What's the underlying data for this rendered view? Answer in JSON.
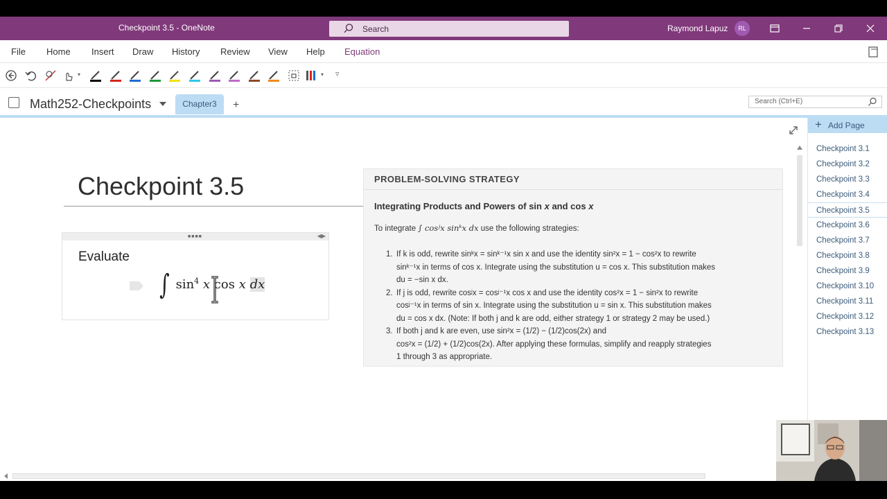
{
  "window": {
    "title": "Checkpoint 3.5  -  OneNote",
    "search_placeholder": "Search",
    "user_name": "Raymond Lapuz",
    "user_initials": "RL"
  },
  "menu": {
    "items": [
      "File",
      "Home",
      "Insert",
      "Draw",
      "History",
      "Review",
      "View",
      "Help",
      "Equation"
    ],
    "active": "Equation"
  },
  "toolbar": {
    "pen_colors": [
      "#000000",
      "#d9251d",
      "#1f6fd1",
      "#1c9a3c",
      "#f3e000",
      "#2ec9e6",
      "#9b59b6",
      "#c06ac9",
      "#8b4a2b",
      "#f08a1c"
    ]
  },
  "notebook": {
    "name": "Math252-Checkpoints",
    "section": "Chapter3",
    "add_section": "+",
    "search_placeholder": "Search (Ctrl+E)"
  },
  "page": {
    "title": "Checkpoint 3.5",
    "evaluate_label": "Evaluate",
    "equation": {
      "integral": "∫",
      "sin": "sin",
      "sin_exp": "4",
      "x1": "x",
      "cos": "cos",
      "x2": "x",
      "dx": "dx"
    }
  },
  "strategy": {
    "header": "PROBLEM-SOLVING STRATEGY",
    "subtitle_a": "Integrating Products and Powers of sin ",
    "subtitle_x1": "x",
    "subtitle_b": " and cos ",
    "subtitle_x2": "x",
    "intro_a": "To integrate ",
    "intro_math": "∫ cosʲx sinᵏx dx",
    "intro_b": " use the following strategies:",
    "items": [
      {
        "num": "1.",
        "line1": "If k is odd, rewrite sinᵏx = sinᵏ⁻¹x sin x and use the identity sin²x = 1 − cos²x to rewrite",
        "line2": "sinᵏ⁻¹x in terms of cos x. Integrate using the substitution u = cos x. This substitution makes",
        "line3": "du = −sin x dx."
      },
      {
        "num": "2.",
        "line1": "If j is odd, rewrite cosʲx = cosʲ⁻¹x cos x and use the identity cos²x = 1 − sin²x to rewrite",
        "line2": "cosʲ⁻¹x in terms of sin x. Integrate using the substitution u = sin x. This substitution makes",
        "line3": "du = cos x dx. (Note: If both j and k are odd, either strategy 1 or strategy 2 may be used.)"
      },
      {
        "num": "3.",
        "line1": "If both j and k are even, use sin²x = (1/2) − (1/2)cos(2x) and",
        "line2": "cos²x = (1/2) + (1/2)cos(2x). After applying these formulas, simplify and reapply strategies",
        "line3": "1 through 3 as appropriate."
      }
    ]
  },
  "pages": {
    "add_label": "Add Page",
    "items": [
      "Checkpoint 3.1",
      "Checkpoint 3.2",
      "Checkpoint 3.3",
      "Checkpoint 3.4",
      "Checkpoint 3.5",
      "Checkpoint 3.6",
      "Checkpoint 3.7",
      "Checkpoint 3.8",
      "Checkpoint 3.9",
      "Checkpoint 3.10",
      "Checkpoint 3.11",
      "Checkpoint 3.12",
      "Checkpoint 3.13"
    ],
    "selected": "Checkpoint 3.5"
  }
}
